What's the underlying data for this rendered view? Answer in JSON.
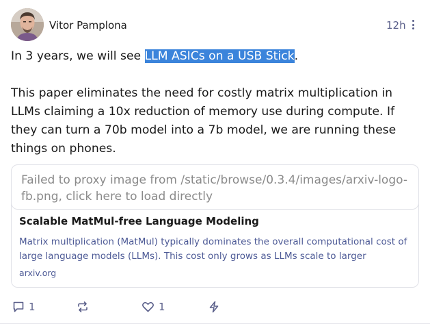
{
  "post": {
    "author": "Vitor Pamplona",
    "time": "12h",
    "text_before": "In 3 years, we will see ",
    "text_highlight": "LLM ASICs on a USB Stick",
    "text_after": ".",
    "paragraph2": "This paper eliminates the need for costly matrix multiplication in LLMs claiming a 10x reduction of memory use during compute. If they can turn a 70b model into a 7b model, we are running these things on phones."
  },
  "link_card": {
    "image_error": "Failed to proxy image from /static/browse/0.3.4/images/arxiv-logo-fb.png, click here to load directly",
    "title": "Scalable MatMul-free Language Modeling",
    "description": "Matrix multiplication (MatMul) typically dominates the overall computational cost of large language models (LLMs). This cost only grows as LLMs scale to larger",
    "domain": "arxiv.org"
  },
  "actions": {
    "reply_count": "1",
    "like_count": "1",
    "icons": [
      "reply-icon",
      "repost-icon",
      "like-icon",
      "zap-icon"
    ]
  },
  "colors": {
    "accent": "#5a5f8a",
    "highlight": "#3b84db",
    "link_text": "#4d5a96"
  }
}
